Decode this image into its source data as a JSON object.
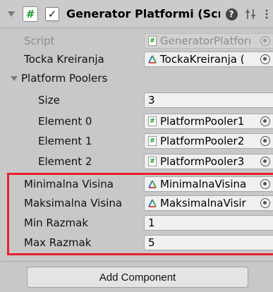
{
  "component": {
    "title": "Generator Platformi (Scrij",
    "enabled_check": "✓",
    "script_glyph": "#"
  },
  "fields": {
    "script": {
      "label": "Script",
      "value": "GeneratorPlatforı"
    },
    "tocka_kreiranja": {
      "label": "Tocka Kreiranja",
      "value": "TockaKreiranja ("
    },
    "platform_poolers": {
      "label": "Platform Poolers",
      "size": {
        "label": "Size",
        "value": "3"
      },
      "elements": [
        {
          "label": "Element 0",
          "value": "PlatformPooler1"
        },
        {
          "label": "Element 1",
          "value": "PlatformPooler2"
        },
        {
          "label": "Element 2",
          "value": "PlatformPooler3"
        }
      ]
    },
    "minimalna_visina": {
      "label": "Minimalna Visina",
      "value": "MinimalnaVisina"
    },
    "maksimalna_visina": {
      "label": "Maksimalna Visina",
      "value": "MaksimalnaVisir"
    },
    "min_razmak": {
      "label": "Min Razmak",
      "value": "1"
    },
    "max_razmak": {
      "label": "Max Razmak",
      "value": "5"
    }
  },
  "add_component": {
    "label": "Add Component"
  },
  "colors": {
    "highlight": "#e8212a",
    "background": "#c8c8c8",
    "field": "#f0f0f0",
    "script_icon": "#1b9c2e",
    "transform_icon": "#2a6fd6"
  },
  "icons": {
    "script": "script-icon",
    "transform": "transform-icon",
    "help": "help-icon",
    "presets": "presets-icon",
    "menu": "kebab-menu-icon",
    "object_picker": "object-picker-icon"
  }
}
